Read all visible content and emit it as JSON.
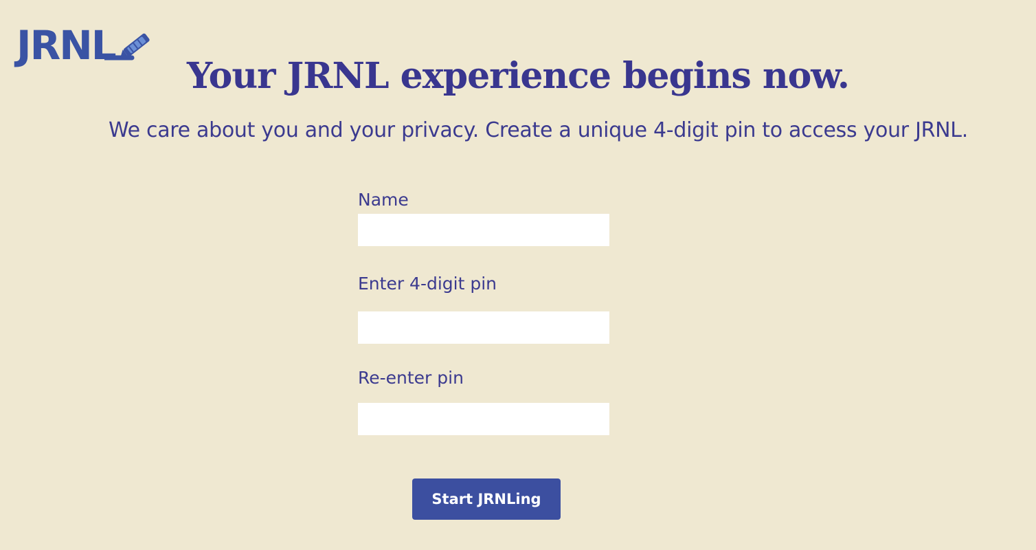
{
  "logo": {
    "text": "JRNL",
    "icon": "pen-icon",
    "color": "#3a53a4"
  },
  "header": {
    "headline": "Your JRNL experience begins now.",
    "subtitle": "We care about you and your privacy. Create a unique 4-digit pin to access your JRNL."
  },
  "form": {
    "name_label": "Name",
    "name_value": "",
    "pin_label": "Enter 4-digit pin",
    "pin_value": "",
    "repin_label": "Re-enter pin",
    "repin_value": "",
    "submit_label": "Start JRNLing"
  },
  "colors": {
    "background": "#efe8d1",
    "text": "#3b3a8f",
    "button": "#3c4fa0",
    "input": "#ffffff"
  }
}
